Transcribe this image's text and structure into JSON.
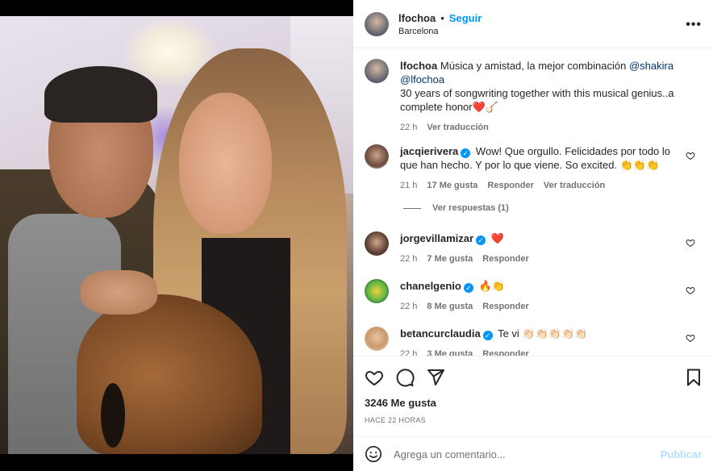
{
  "header": {
    "username": "lfochoa",
    "separator": "•",
    "follow_label": "Seguir",
    "location": "Barcelona",
    "more_label": "•••"
  },
  "caption": {
    "username": "lfochoa",
    "text_prefix": "Música y amistad, la mejor combinación",
    "mention1": "@shakira",
    "mention2": "@lfochoa",
    "line2": "30 years of songwriting together with this musical genius..a complete honor❤️🪕",
    "time": "22 h",
    "translate": "Ver traducción"
  },
  "comments": [
    {
      "username": "jacqierivera",
      "verified": true,
      "text": "Wow! Que orgullo. Felicidades por todo lo que han hecho. Y por lo que viene. So excited. 👏👏👏",
      "time": "21 h",
      "likes": "17 Me gusta",
      "reply": "Responder",
      "translate": "Ver traducción"
    },
    {
      "username": "jorgevillamizar",
      "verified": true,
      "text": "❤️",
      "time": "22 h",
      "likes": "7 Me gusta",
      "reply": "Responder"
    },
    {
      "username": "chanelgenio",
      "verified": true,
      "text": "🔥👏",
      "time": "22 h",
      "likes": "8 Me gusta",
      "reply": "Responder"
    },
    {
      "username": "betancurclaudia",
      "verified": true,
      "text": "Te vi 👏🏻👏🏻👏🏻👏🏻👏🏻",
      "time": "22 h",
      "likes": "3 Me gusta",
      "reply": "Responder"
    }
  ],
  "view_replies": "Ver respuestas (1)",
  "verified_mark": "✓",
  "actions": {
    "likes_count": "3246 Me gusta",
    "posted_ago": "HACE 22 HORAS"
  },
  "add_comment": {
    "placeholder": "Agrega un comentario...",
    "publish_label": "Publicar",
    "emoji_icon": "smiley-icon"
  },
  "colors": {
    "accent": "#0095f6",
    "mention": "#00376b",
    "muted": "#737373",
    "publish_disabled": "#b2dffc"
  }
}
